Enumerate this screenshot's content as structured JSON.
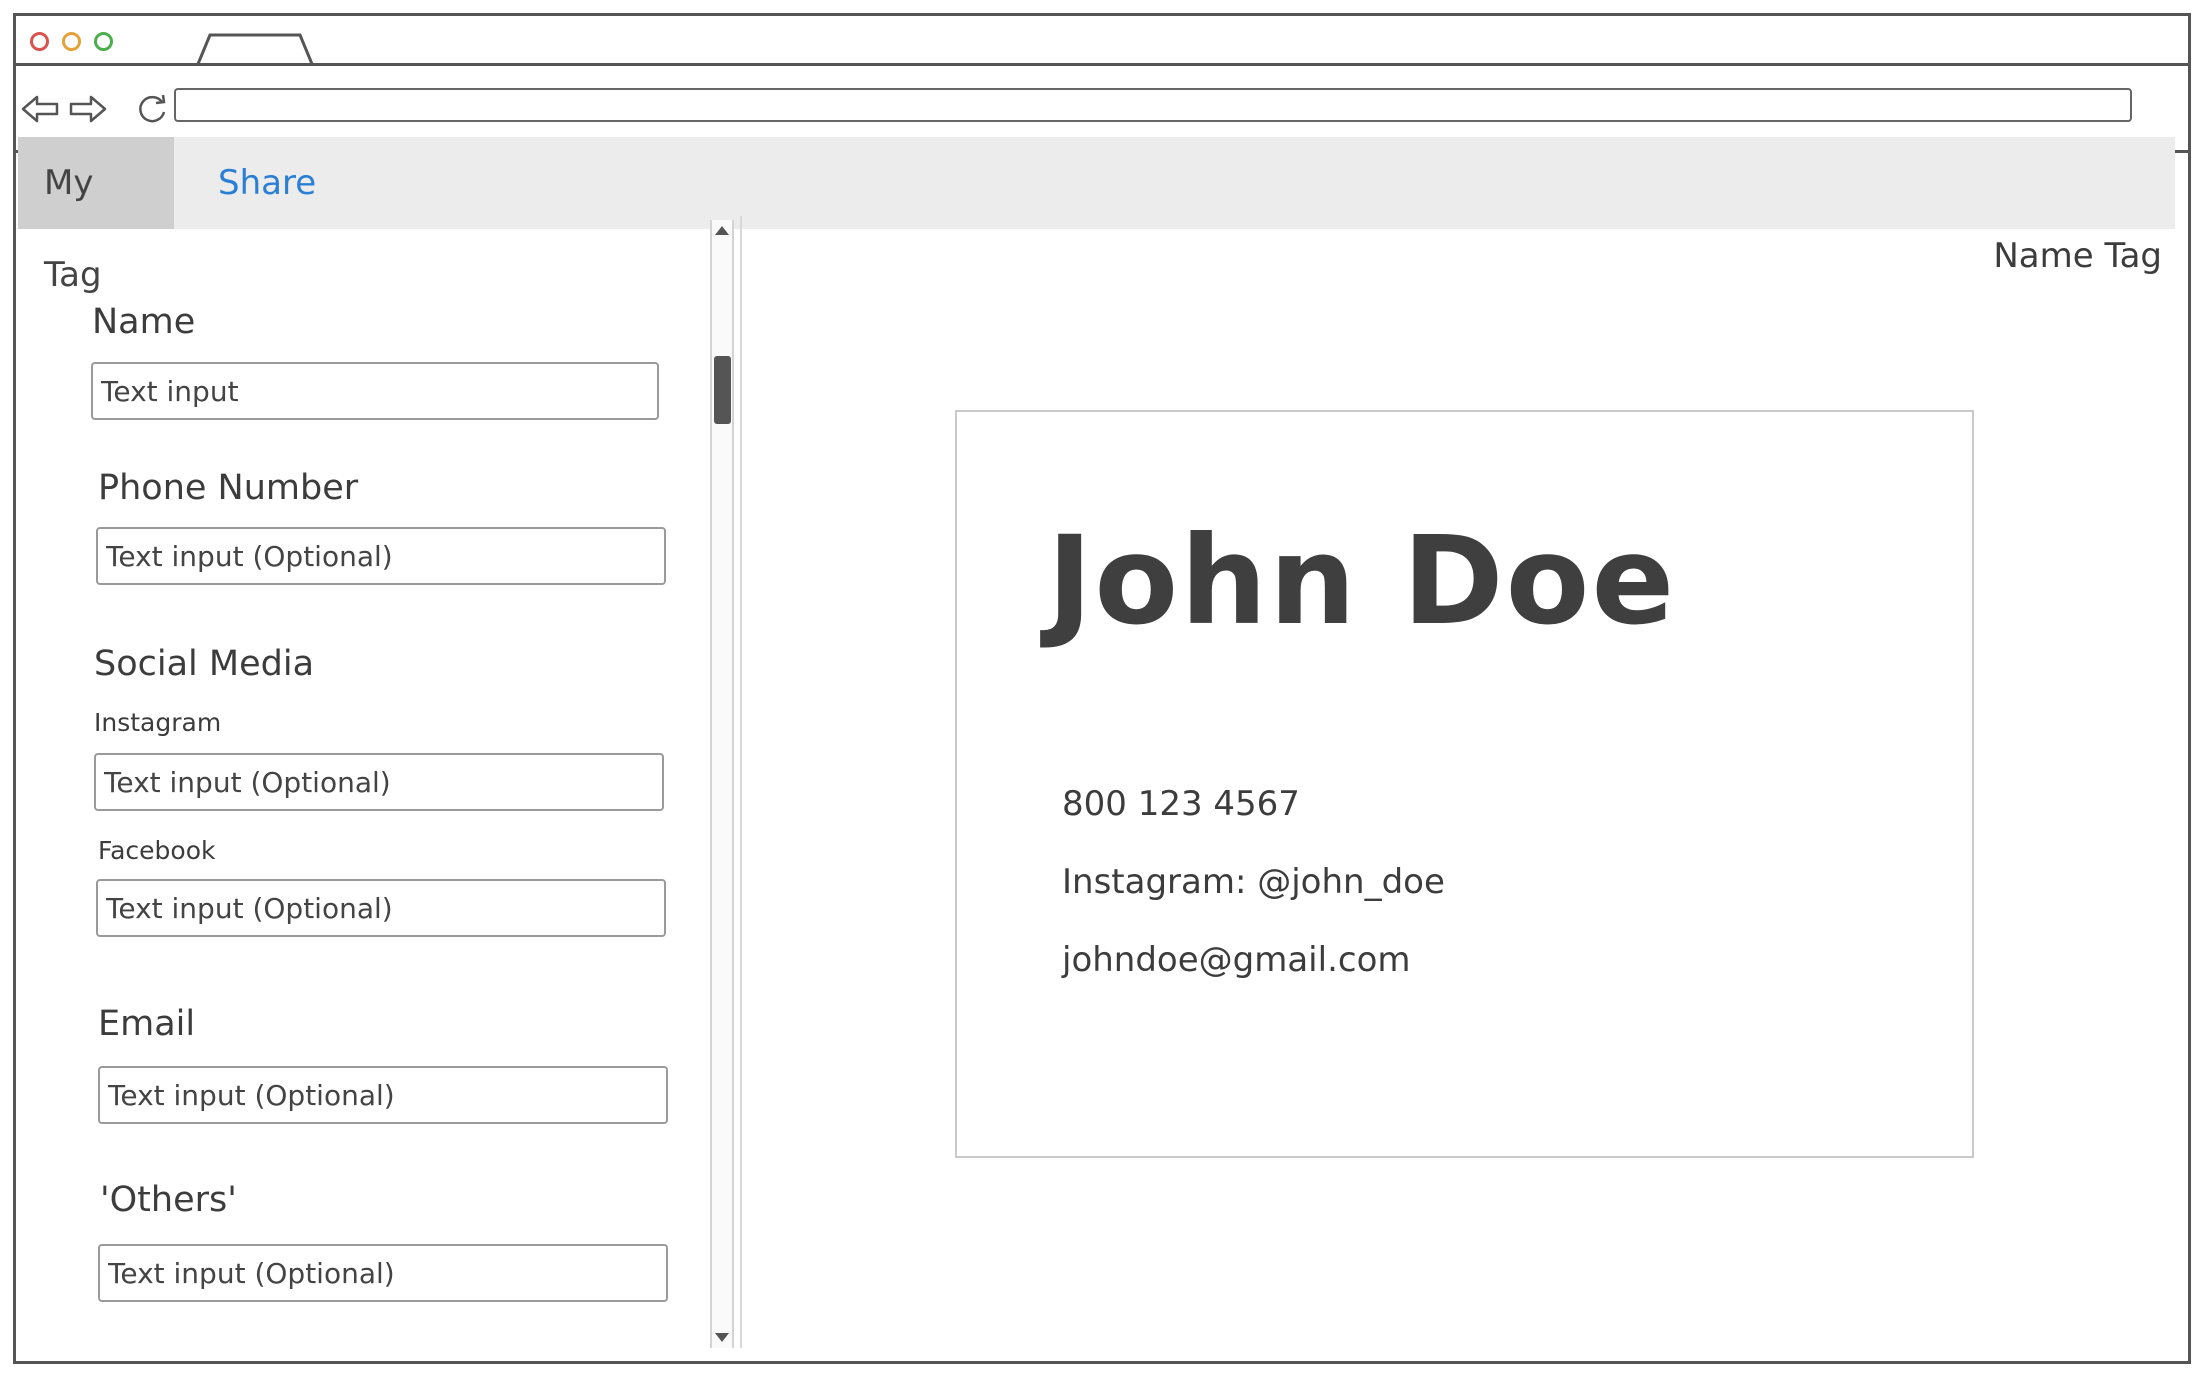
{
  "browser": {
    "url": ""
  },
  "tabs": {
    "my_tag": "My Tag",
    "share": "Share"
  },
  "form": {
    "name": {
      "label": "Name",
      "placeholder": "Text input"
    },
    "phone": {
      "label": "Phone Number",
      "placeholder": "Text input (Optional)"
    },
    "social": {
      "label": "Social Media",
      "instagram": {
        "label": "Instagram",
        "placeholder": "Text input (Optional)"
      },
      "facebook": {
        "label": "Facebook",
        "placeholder": "Text input (Optional)"
      }
    },
    "email": {
      "label": "Email",
      "placeholder": "Text input (Optional)"
    },
    "others": {
      "label": "'Others'",
      "placeholder": "Text input (Optional)"
    }
  },
  "preview": {
    "title": "Name Tag",
    "name": "John Doe",
    "phone": "800 123 4567",
    "instagram": "Instagram: @john_doe",
    "email": "johndoe@gmail.com"
  },
  "colors": {
    "link": "#2a7fd4",
    "tab_active_bg": "#cfcfcf",
    "tabbar_bg": "#ececec"
  }
}
